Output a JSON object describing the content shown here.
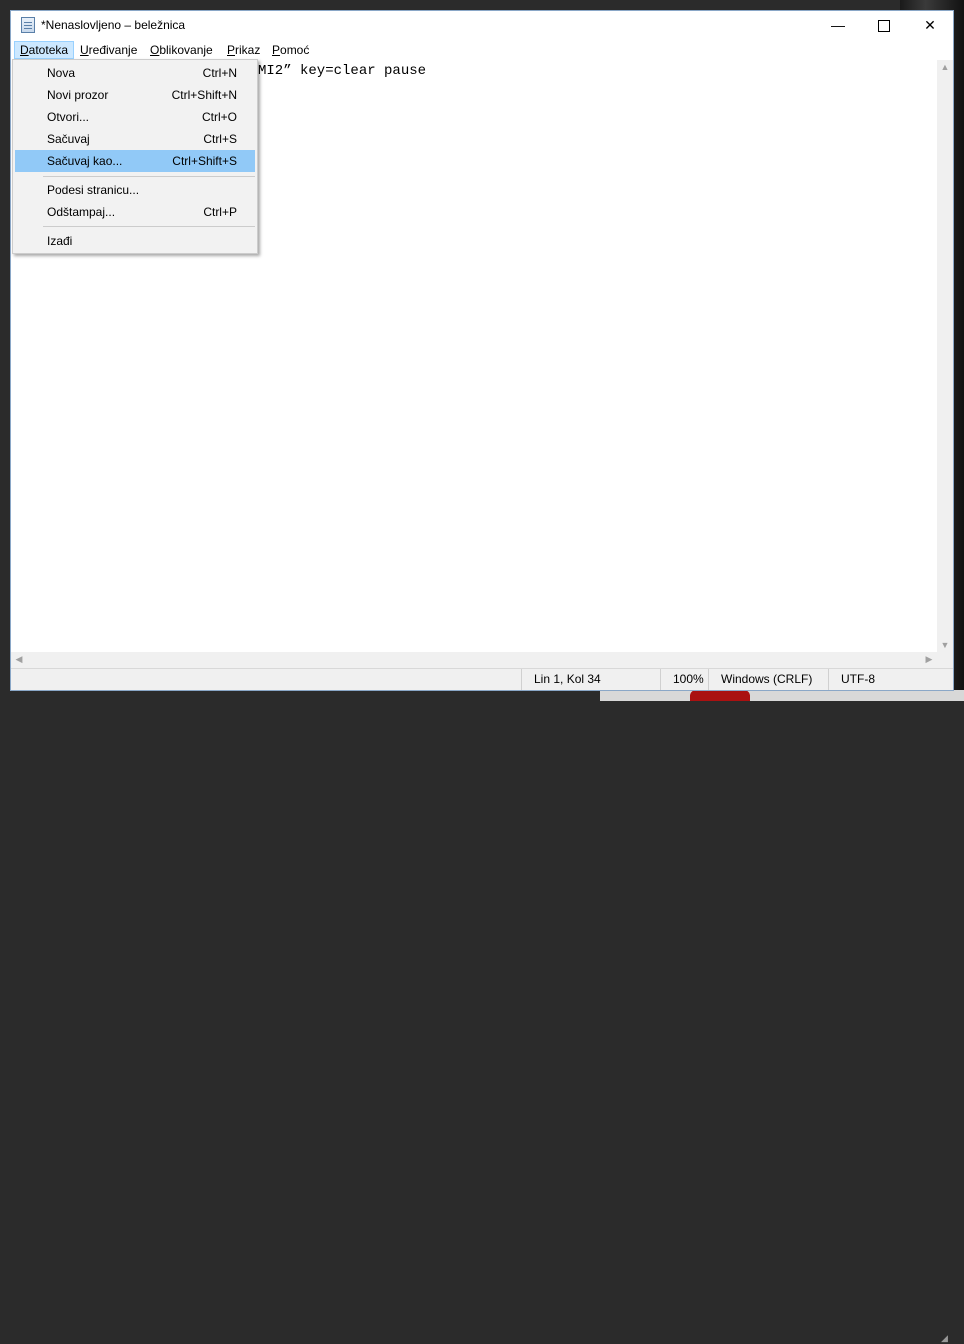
{
  "window": {
    "title": "*Nenaslovljeno – beležnica"
  },
  "titlebar_buttons": {
    "minimize": "—",
    "close": "✕"
  },
  "menubar": [
    {
      "label": "Datoteka",
      "accel": "D",
      "rest": "atoteka"
    },
    {
      "label": "Uređivanje",
      "accel": "U",
      "rest": "ređivanje"
    },
    {
      "label": "Oblikovanje",
      "accel": "O",
      "rest": "blikovanje"
    },
    {
      "label": "Prikaz",
      "accel": "P",
      "rest": "rikaz"
    },
    {
      "label": "Pomoć",
      "accel": "P",
      "rest": "omoć"
    }
  ],
  "file_menu": {
    "items": [
      {
        "label": "Nova",
        "shortcut": "Ctrl+N"
      },
      {
        "label": "Novi prozor",
        "shortcut": "Ctrl+Shift+N"
      },
      {
        "label": "Otvori...",
        "shortcut": "Ctrl+O"
      },
      {
        "label": "Sačuvaj",
        "shortcut": "Ctrl+S"
      },
      {
        "label": "Sačuvaj kao...",
        "shortcut": "Ctrl+Shift+S",
        "highlighted": true
      },
      {
        "label": "Podesi stranicu...",
        "shortcut": ""
      },
      {
        "label": "Odštampaj...",
        "shortcut": "Ctrl+P"
      },
      {
        "label": "Izađi",
        "shortcut": ""
      }
    ]
  },
  "editor": {
    "visible_text": "MI2” key=clear pause"
  },
  "statusbar": {
    "position": "Lin 1, Kol 34",
    "zoom": "100%",
    "line_ending": "Windows (CRLF)",
    "encoding": "UTF-8"
  },
  "colors": {
    "highlight": "#91c9f7",
    "menu_active": "#cce8ff"
  }
}
